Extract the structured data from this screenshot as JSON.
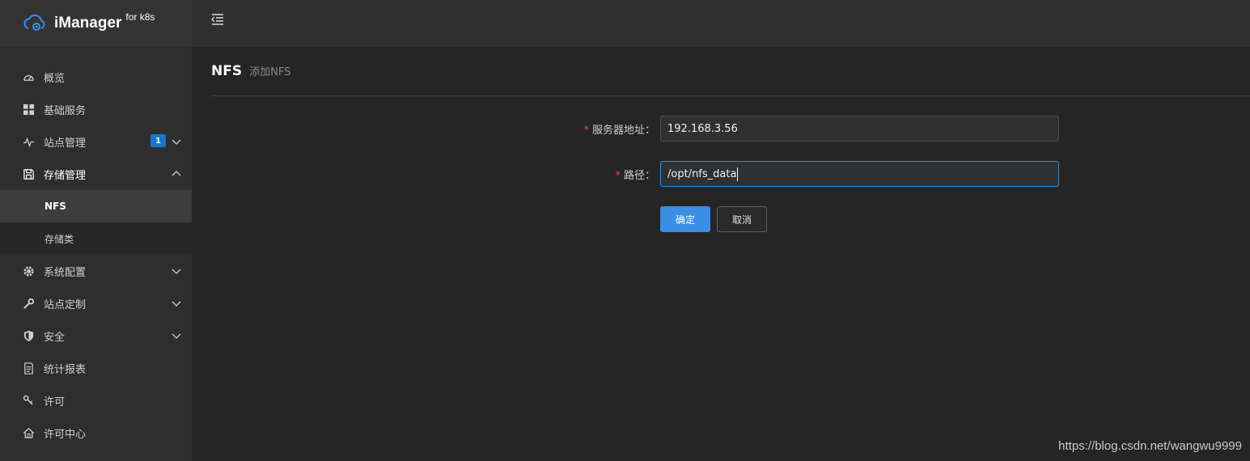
{
  "brand": {
    "name": "iManager",
    "suffix": "for k8s"
  },
  "sidebar": {
    "items": [
      {
        "label": "概览"
      },
      {
        "label": "基础服务"
      },
      {
        "label": "站点管理",
        "badge": "1"
      },
      {
        "label": "存储管理"
      },
      {
        "label": "系统配置"
      },
      {
        "label": "站点定制"
      },
      {
        "label": "安全"
      },
      {
        "label": "统计报表"
      },
      {
        "label": "许可"
      },
      {
        "label": "许可中心"
      }
    ],
    "storage_sub": [
      {
        "label": "NFS"
      },
      {
        "label": "存储类"
      }
    ]
  },
  "page": {
    "title": "NFS",
    "subtitle": "添加NFS"
  },
  "form": {
    "server": {
      "label": "服务器地址：",
      "value": "192.168.3.56"
    },
    "path": {
      "label": "路径：",
      "value": "/opt/nfs_data"
    },
    "confirm_label": "确定",
    "cancel_label": "取消"
  },
  "watermark": "https://blog.csdn.net/wangwu9999",
  "colors": {
    "accent": "#3a8ee6",
    "badge": "#1976c8",
    "required": "#e04a3f"
  }
}
